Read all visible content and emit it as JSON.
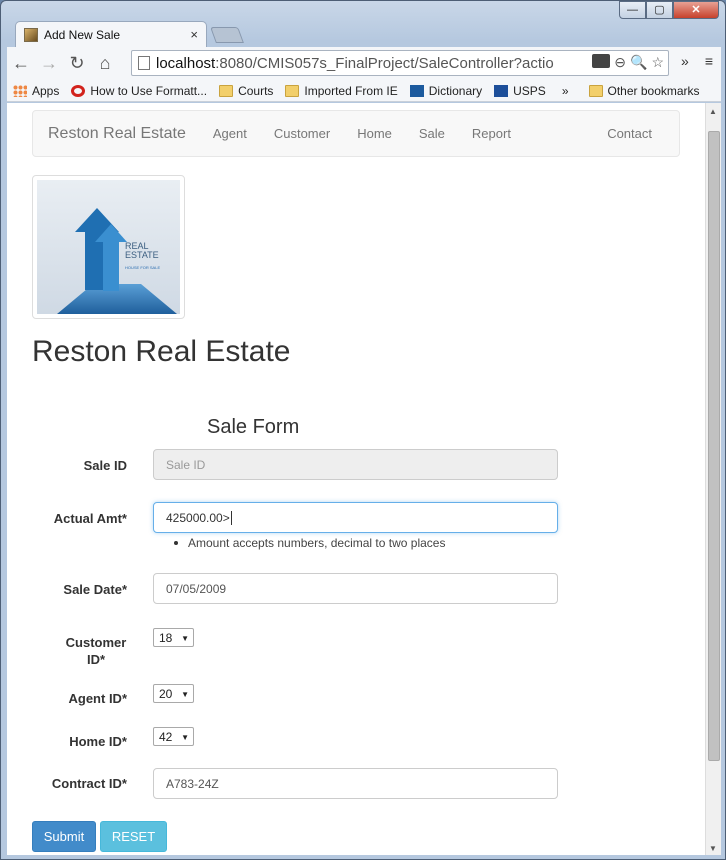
{
  "window": {
    "controls": [
      "—",
      "▢",
      "✕"
    ]
  },
  "tab": {
    "title": "Add New Sale",
    "close": "×"
  },
  "toolbar": {
    "back": "←",
    "forward": "→",
    "reload": "↻",
    "home": "⌂",
    "url_host": "localhost",
    "url_rest": ":8080/CMIS057s_FinalProject/SaleController?actio",
    "more": "»",
    "menu": "≡"
  },
  "bookmarks": {
    "items": [
      "Apps",
      "How to Use Formatt...",
      "Courts",
      "Imported From IE",
      "Dictionary",
      "USPS"
    ],
    "overflow": "»",
    "other": "Other bookmarks"
  },
  "navbar": {
    "brand": "Reston Real Estate",
    "links": [
      "Agent",
      "Customer",
      "Home",
      "Sale",
      "Report"
    ],
    "contact": "Contact"
  },
  "logo": {
    "line1": "REAL",
    "line2": "ESTATE",
    "tag": "HOUSE FOR SALE"
  },
  "page": {
    "title": "Reston Real Estate",
    "form_title": "Sale Form"
  },
  "form": {
    "sale_id_label": "Sale ID",
    "sale_id_placeholder": "Sale ID",
    "actual_amt_label": "Actual Amt*",
    "actual_amt_value": "425000.00>",
    "actual_amt_hint": "Amount accepts numbers, decimal to two places",
    "sale_date_label": "Sale Date*",
    "sale_date_value": "07/05/2009",
    "customer_id_label": "Customer ID*",
    "customer_id_value": "18",
    "agent_id_label": "Agent ID*",
    "agent_id_value": "20",
    "home_id_label": "Home ID*",
    "home_id_value": "42",
    "contract_id_label": "Contract ID*",
    "contract_id_value": "A783-24Z",
    "submit_label": "Submit",
    "reset_label": "RESET"
  },
  "colors": {
    "primary": "#428bca",
    "info": "#5bc0de",
    "focus": "#66afe9"
  }
}
